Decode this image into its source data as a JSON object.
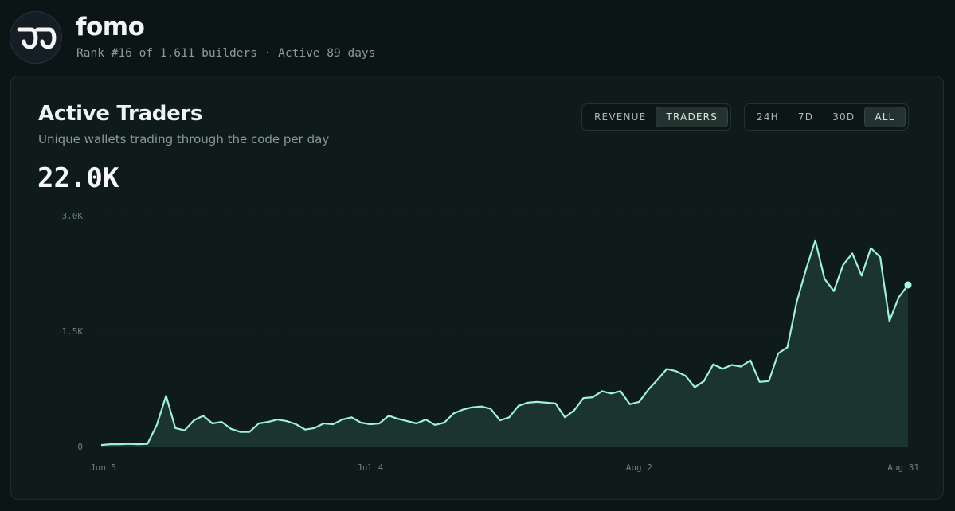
{
  "header": {
    "app_name": "fomo",
    "subline": "Rank #16 of 1.611 builders · Active 89 days"
  },
  "panel": {
    "title": "Active Traders",
    "subtitle": "Unique wallets trading through the code per day",
    "big_value": "22.0K",
    "metric_toggle": [
      {
        "label": "REVENUE",
        "active": false
      },
      {
        "label": "TRADERS",
        "active": true
      }
    ],
    "range_toggle": [
      {
        "label": "24H",
        "active": false
      },
      {
        "label": "7D",
        "active": false
      },
      {
        "label": "30D",
        "active": false
      },
      {
        "label": "ALL",
        "active": true
      }
    ]
  },
  "colors": {
    "line": "#9ff2d8",
    "area": "#1d3a34",
    "accent": "#a7f7de"
  },
  "chart_data": {
    "type": "area",
    "ylim": [
      0,
      3000
    ],
    "y_ticks": [
      {
        "value": 3000,
        "label": "3.0K"
      },
      {
        "value": 1500,
        "label": "1.5K"
      },
      {
        "value": 0,
        "label": "0"
      }
    ],
    "x_ticks": [
      {
        "index": 0,
        "label": "Jun 5"
      },
      {
        "index": 29,
        "label": "Jul 4"
      },
      {
        "index": 58,
        "label": "Aug 2"
      },
      {
        "index": 87,
        "label": "Aug 31"
      }
    ],
    "values": [
      20,
      30,
      30,
      35,
      30,
      35,
      280,
      660,
      240,
      210,
      340,
      400,
      300,
      320,
      230,
      190,
      190,
      300,
      320,
      350,
      330,
      290,
      220,
      240,
      300,
      290,
      350,
      380,
      310,
      290,
      300,
      400,
      360,
      330,
      300,
      350,
      280,
      310,
      430,
      480,
      510,
      520,
      490,
      340,
      380,
      530,
      570,
      580,
      570,
      560,
      380,
      470,
      630,
      640,
      720,
      690,
      720,
      550,
      580,
      740,
      870,
      1010,
      980,
      920,
      770,
      850,
      1070,
      1010,
      1060,
      1040,
      1120,
      840,
      850,
      1210,
      1290,
      1880,
      2300,
      2680,
      2180,
      2020,
      2360,
      2510,
      2220,
      2580,
      2460,
      1630,
      1940,
      2100
    ]
  }
}
